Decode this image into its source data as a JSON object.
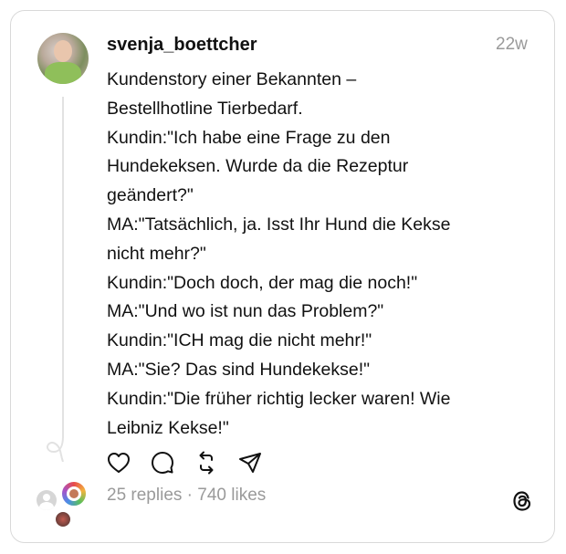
{
  "post": {
    "username": "svenja_boettcher",
    "time": "22w",
    "lines": [
      "Kundenstory einer Bekannten –",
      "Bestellhotline Tierbedarf.",
      "Kundin:\"Ich habe eine Frage zu den",
      "Hundekeksen. Wurde da die Rezeptur",
      "geändert?\"",
      "MA:\"Tatsächlich, ja. Isst Ihr Hund die Kekse",
      "nicht mehr?\"",
      "Kundin:\"Doch doch, der mag die noch!\"",
      "MA:\"Und wo ist nun das Problem?\"",
      "Kundin:\"ICH mag die nicht mehr!\"",
      "MA:\"Sie? Das sind Hundekekse!\"",
      "Kundin:\"Die früher richtig lecker waren! Wie",
      "Leibniz Kekse!\""
    ],
    "stats": "25 replies · 740 likes"
  },
  "actions": {
    "like": "heart-icon",
    "comment": "comment-icon",
    "repost": "repost-icon",
    "share": "share-icon"
  },
  "branding": {
    "logo": "threads-logo-icon"
  },
  "colors": {
    "muted": "#9a9a9a",
    "border": "#d9d9d9",
    "text": "#111111"
  }
}
